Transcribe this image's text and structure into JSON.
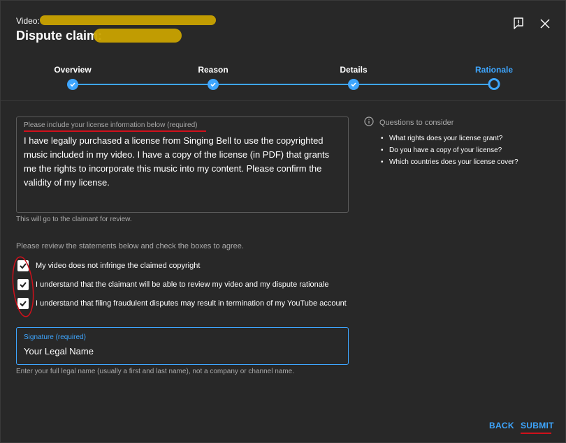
{
  "header": {
    "video_label": "Video:",
    "title": "Dispute claim:",
    "report_icon": "report-flag-icon",
    "close_icon": "close-icon"
  },
  "stepper": {
    "steps": [
      {
        "label": "Overview",
        "state": "completed"
      },
      {
        "label": "Reason",
        "state": "completed"
      },
      {
        "label": "Details",
        "state": "completed"
      },
      {
        "label": "Rationale",
        "state": "current"
      }
    ]
  },
  "license": {
    "label": "Please include your license information below (required)",
    "value": "I have legally purchased a license from Singing Bell to use the copyrighted music included in my video. I have a copy of the license (in PDF) that grants me the rights to incorporate this music into my content. Please confirm the validity of my license.",
    "helper": "This will go to the claimant for review."
  },
  "questions": {
    "heading": "Questions to consider",
    "items": [
      "What rights does your license grant?",
      "Do you have a copy of your license?",
      "Which countries does your license cover?"
    ]
  },
  "statements": {
    "intro": "Please review the statements below and check the boxes to agree.",
    "items": [
      {
        "label": "My video does not infringe the claimed copyright",
        "checked": true
      },
      {
        "label": "I understand that the claimant will be able to review my video and my dispute rationale",
        "checked": true
      },
      {
        "label": "I understand that filing fraudulent disputes may result in termination of my YouTube account",
        "checked": true
      }
    ]
  },
  "signature": {
    "label": "Signature (required)",
    "value": "Your Legal Name",
    "helper": "Enter your full legal name (usually a first and last name), not a company or channel name."
  },
  "footer": {
    "back_label": "BACK",
    "submit_label": "SUBMIT"
  },
  "colors": {
    "accent": "#3ea6ff",
    "background": "#282828",
    "annotation_red": "#d0101b",
    "redaction": "#c9a200"
  }
}
